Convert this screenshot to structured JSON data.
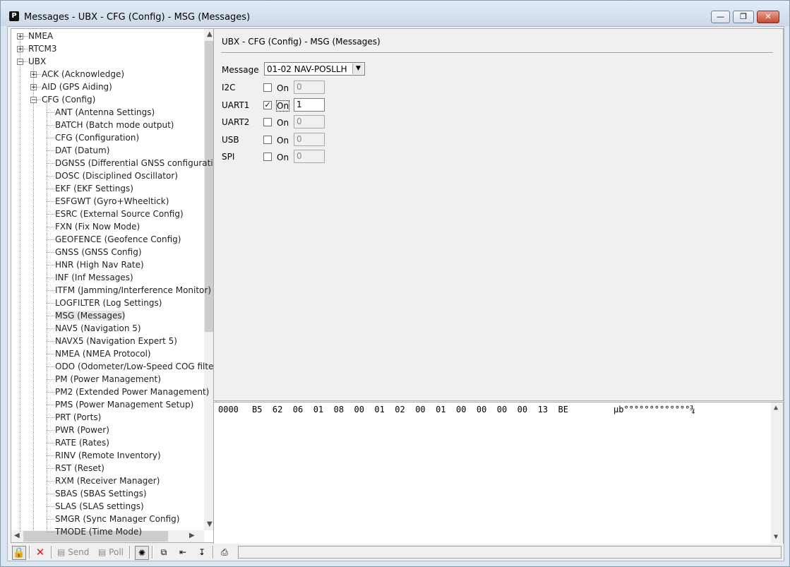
{
  "window": {
    "title": "Messages - UBX - CFG (Config) - MSG (Messages)",
    "app_icon": "P"
  },
  "tree": {
    "nodes": [
      {
        "label": "NMEA",
        "level": 0,
        "expander": "+"
      },
      {
        "label": "RTCM3",
        "level": 0,
        "expander": "+"
      },
      {
        "label": "UBX",
        "level": 0,
        "expander": "-"
      },
      {
        "label": "ACK (Acknowledge)",
        "level": 1,
        "expander": "+"
      },
      {
        "label": "AID (GPS Aiding)",
        "level": 1,
        "expander": "+"
      },
      {
        "label": "CFG (Config)",
        "level": 1,
        "expander": "-"
      },
      {
        "label": "ANT (Antenna Settings)",
        "level": 2
      },
      {
        "label": "BATCH (Batch mode output)",
        "level": 2
      },
      {
        "label": "CFG (Configuration)",
        "level": 2
      },
      {
        "label": "DAT (Datum)",
        "level": 2
      },
      {
        "label": "DGNSS (Differential GNSS configurati",
        "level": 2
      },
      {
        "label": "DOSC (Disciplined Oscillator)",
        "level": 2
      },
      {
        "label": "EKF (EKF Settings)",
        "level": 2
      },
      {
        "label": "ESFGWT (Gyro+Wheeltick)",
        "level": 2
      },
      {
        "label": "ESRC (External Source Config)",
        "level": 2
      },
      {
        "label": "FXN (Fix Now Mode)",
        "level": 2
      },
      {
        "label": "GEOFENCE (Geofence Config)",
        "level": 2
      },
      {
        "label": "GNSS (GNSS Config)",
        "level": 2
      },
      {
        "label": "HNR (High Nav Rate)",
        "level": 2
      },
      {
        "label": "INF (Inf Messages)",
        "level": 2
      },
      {
        "label": "ITFM (Jamming/Interference Monitor)",
        "level": 2
      },
      {
        "label": "LOGFILTER (Log Settings)",
        "level": 2
      },
      {
        "label": "MSG (Messages)",
        "level": 2,
        "selected": true
      },
      {
        "label": "NAV5 (Navigation 5)",
        "level": 2
      },
      {
        "label": "NAVX5 (Navigation Expert 5)",
        "level": 2
      },
      {
        "label": "NMEA (NMEA Protocol)",
        "level": 2
      },
      {
        "label": "ODO (Odometer/Low-Speed COG filte",
        "level": 2
      },
      {
        "label": "PM (Power Management)",
        "level": 2
      },
      {
        "label": "PM2 (Extended Power Management)",
        "level": 2
      },
      {
        "label": "PMS (Power Management Setup)",
        "level": 2
      },
      {
        "label": "PRT (Ports)",
        "level": 2
      },
      {
        "label": "PWR (Power)",
        "level": 2
      },
      {
        "label": "RATE (Rates)",
        "level": 2
      },
      {
        "label": "RINV (Remote Inventory)",
        "level": 2
      },
      {
        "label": "RST (Reset)",
        "level": 2
      },
      {
        "label": "RXM (Receiver Manager)",
        "level": 2
      },
      {
        "label": "SBAS (SBAS Settings)",
        "level": 2
      },
      {
        "label": "SLAS (SLAS settings)",
        "level": 2
      },
      {
        "label": "SMGR (Sync Manager Config)",
        "level": 2
      },
      {
        "label": "TMODE (Time Mode)",
        "level": 2
      }
    ]
  },
  "config": {
    "title": "UBX - CFG (Config) - MSG (Messages)",
    "message_label": "Message",
    "message_value": "01-02 NAV-POSLLH",
    "ports": [
      {
        "name": "I2C",
        "on_label": "On",
        "checked": false,
        "rate": "0"
      },
      {
        "name": "UART1",
        "on_label": "On",
        "checked": true,
        "rate": "1"
      },
      {
        "name": "UART2",
        "on_label": "On",
        "checked": false,
        "rate": "0"
      },
      {
        "name": "USB",
        "on_label": "On",
        "checked": false,
        "rate": "0"
      },
      {
        "name": "SPI",
        "on_label": "On",
        "checked": false,
        "rate": "0"
      }
    ]
  },
  "hex": {
    "offset": "0000",
    "bytes": "B5  62  06  01  08  00  01  02  00  01  00  00  00  00  13  BE",
    "ascii": "µb°°°°°°°°°°°°°¾"
  },
  "toolbar": {
    "send_label": "Send",
    "poll_label": "Poll"
  }
}
